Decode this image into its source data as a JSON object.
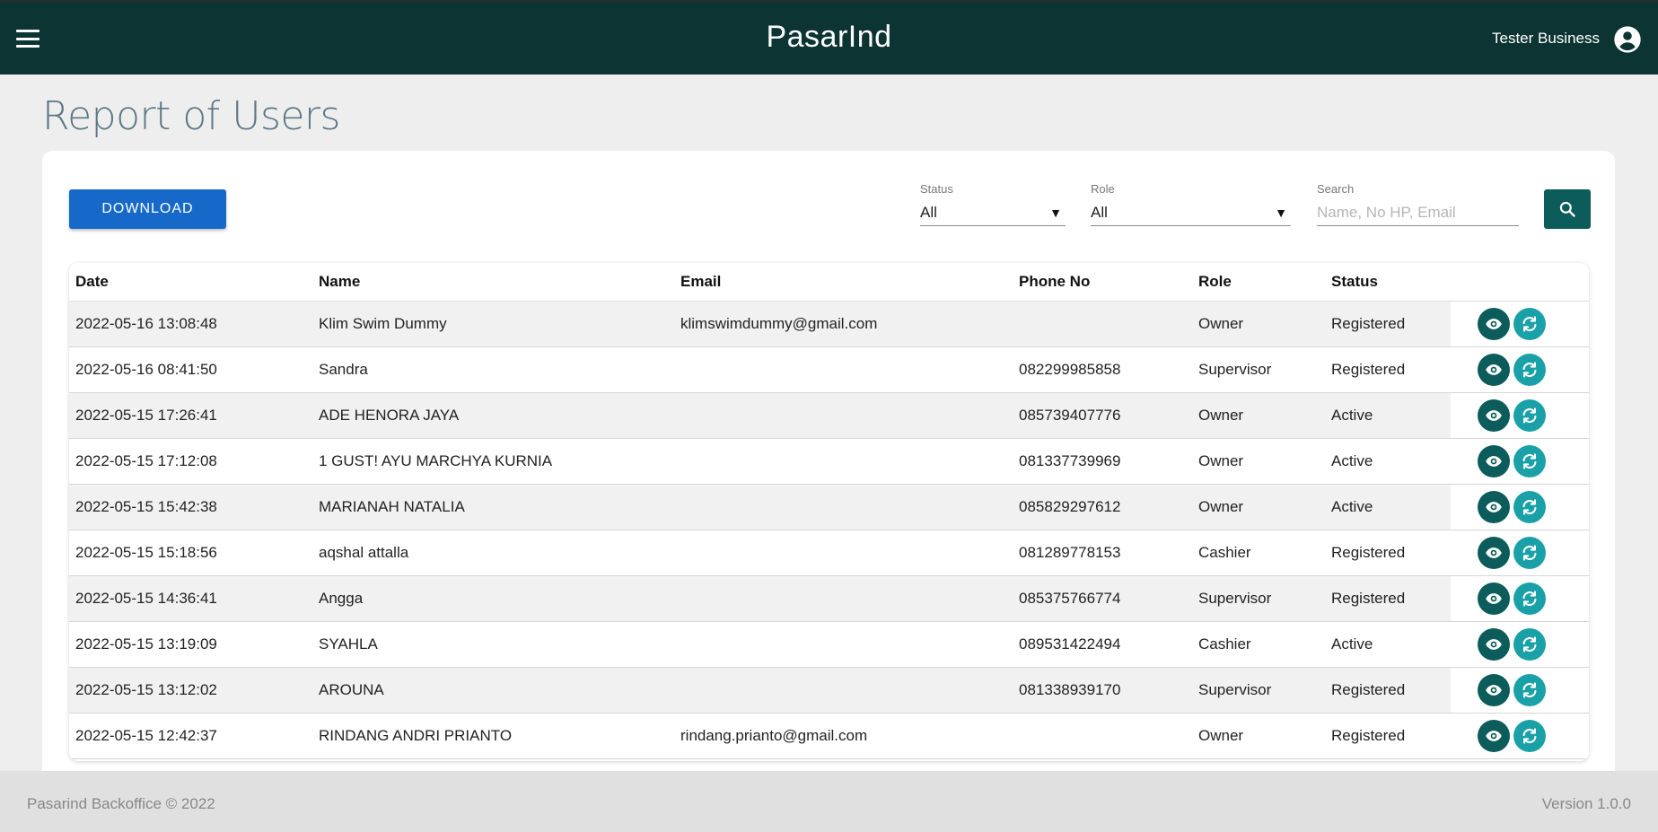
{
  "header": {
    "app_title": "PasarInd",
    "user_name": "Tester Business"
  },
  "page": {
    "title": "Report of Users"
  },
  "toolbar": {
    "download_label": "DOWNLOAD",
    "status_label": "Status",
    "status_value": "All",
    "role_label": "Role",
    "role_value": "All",
    "search_label": "Search",
    "search_placeholder": "Name, No HP, Email"
  },
  "table": {
    "columns": [
      "Date",
      "Name",
      "Email",
      "Phone No",
      "Role",
      "Status"
    ],
    "rows": [
      [
        "2022-05-16 13:08:48",
        "Klim Swim Dummy",
        "klimswimdummy@gmail.com",
        "",
        "Owner",
        "Registered"
      ],
      [
        "2022-05-16 08:41:50",
        "Sandra",
        "",
        "082299985858",
        "Supervisor",
        "Registered"
      ],
      [
        "2022-05-15 17:26:41",
        "ADE HENORA JAYA",
        "",
        "085739407776",
        "Owner",
        "Active"
      ],
      [
        "2022-05-15 17:12:08",
        "1 GUST! AYU MARCHYA KURNIA",
        "",
        "081337739969",
        "Owner",
        "Active"
      ],
      [
        "2022-05-15 15:42:38",
        "MARIANAH NATALIA",
        "",
        "085829297612",
        "Owner",
        "Active"
      ],
      [
        "2022-05-15 15:18:56",
        "aqshal attalla",
        "",
        "081289778153",
        "Cashier",
        "Registered"
      ],
      [
        "2022-05-15 14:36:41",
        "Angga",
        "",
        "085375766774",
        "Supervisor",
        "Registered"
      ],
      [
        "2022-05-15 13:19:09",
        "SYAHLA",
        "",
        "089531422494",
        "Cashier",
        "Active"
      ],
      [
        "2022-05-15 13:12:02",
        "AROUNA",
        "",
        "081338939170",
        "Supervisor",
        "Registered"
      ],
      [
        "2022-05-15 12:42:37",
        "RINDANG ANDRI PRIANTO",
        "rindang.prianto@gmail.com",
        "",
        "Owner",
        "Registered"
      ]
    ]
  },
  "footer": {
    "left": "Pasarind Backoffice © 2022",
    "right": "Version 1.0.0"
  },
  "colors": {
    "header_bg": "#0b3433",
    "primary": "#1769c9",
    "view_btn": "#0b5c5a",
    "sync_btn": "#1aa1a8"
  },
  "icons": {
    "menu": "hamburger-icon",
    "user": "account-circle-icon",
    "search": "search-icon",
    "view": "eye-icon",
    "sync": "sync-icon"
  }
}
